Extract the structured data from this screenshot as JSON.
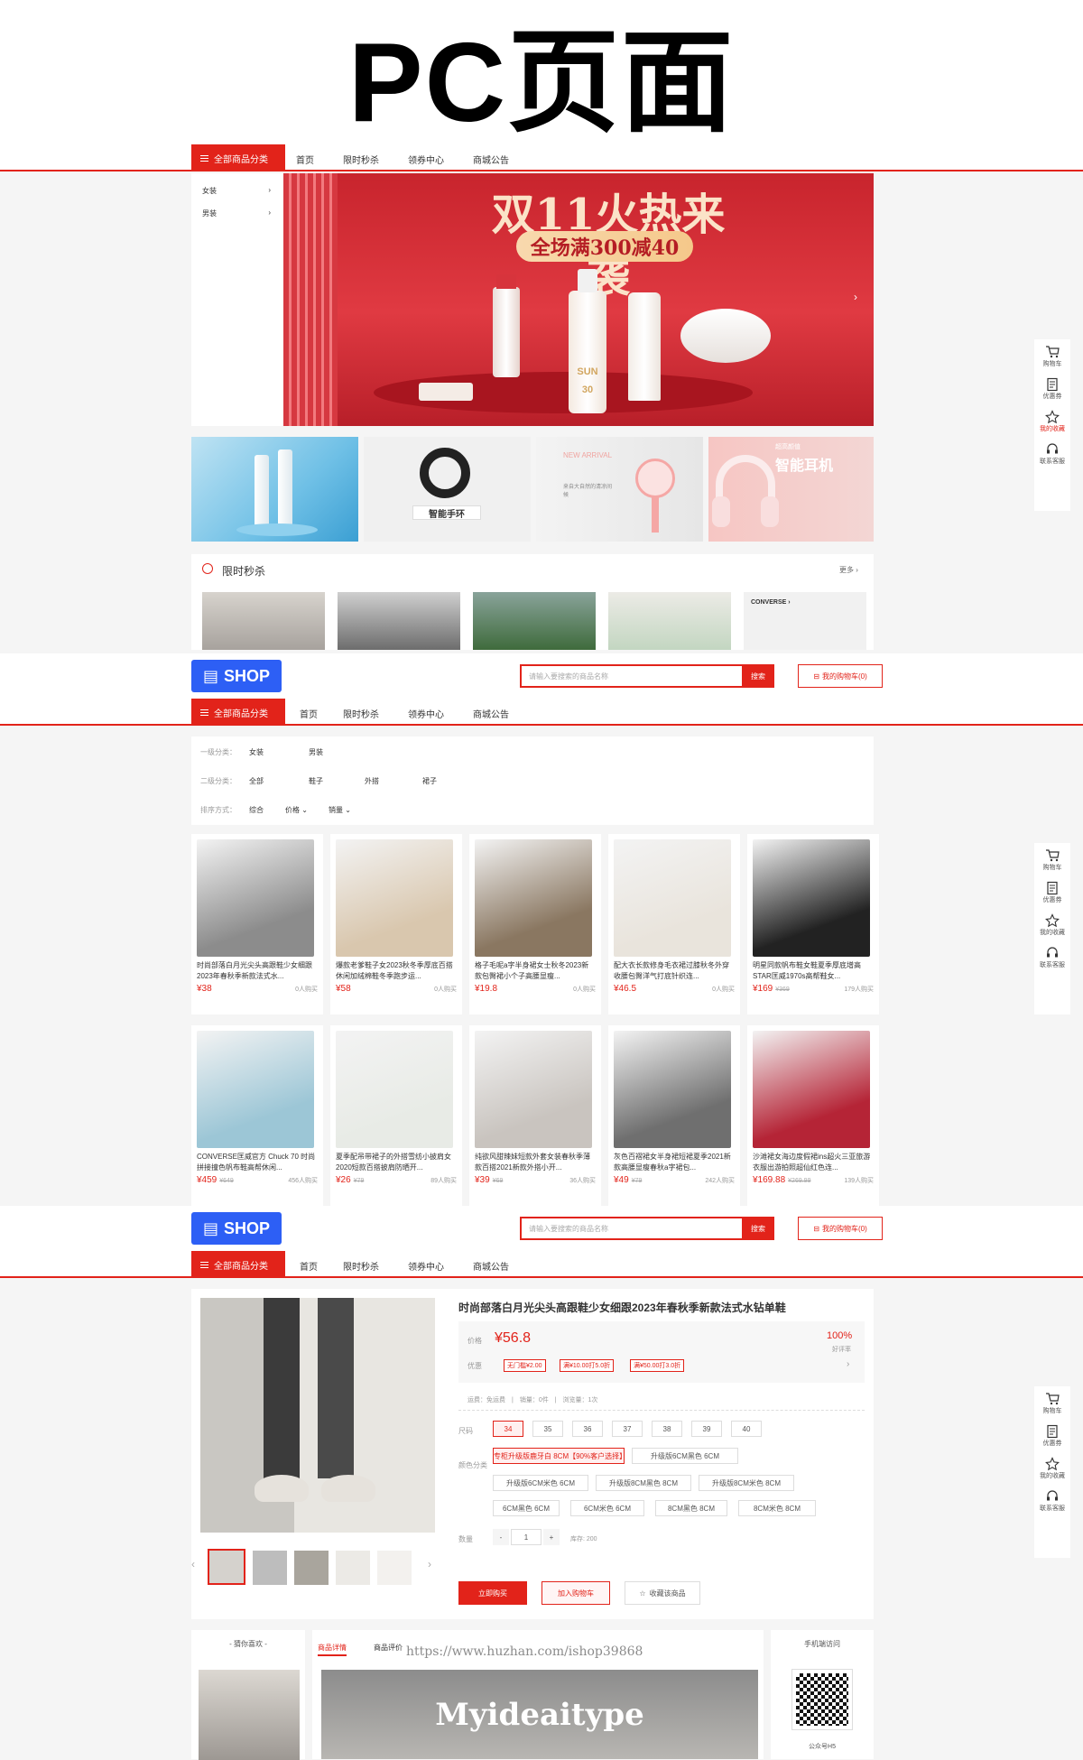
{
  "page_title": "PC页面",
  "nav": {
    "all": "全部商品分类",
    "items": [
      "首页",
      "限时秒杀",
      "领券中心",
      "商城公告"
    ]
  },
  "categories": [
    "女装",
    "男装"
  ],
  "banner": {
    "headline": "双11火热来袭",
    "sub": "全场满300减40",
    "tube_text": "SUN",
    "tube_num": "30"
  },
  "promos": [
    {
      "text": ""
    },
    {
      "text": "智能手环"
    },
    {
      "text": "NEW ARRIVAL",
      "text2": "来自大自然的清凉间候"
    },
    {
      "text": "超高颜值",
      "text2": "智能耳机"
    }
  ],
  "flash": {
    "title": "限时秒杀",
    "more": "更多"
  },
  "sidebar": [
    {
      "icon": "cart-icon",
      "label": "购物车"
    },
    {
      "icon": "coupon-icon",
      "label": "优惠券"
    },
    {
      "icon": "star-icon",
      "label": "我的收藏"
    },
    {
      "icon": "headset-icon",
      "label": "联系客服"
    }
  ],
  "shop": {
    "logo": "SHOP",
    "search_placeholder": "请输入要搜索的商品名称",
    "search_btn": "搜索",
    "cart": "我的购物车(0)"
  },
  "filter": {
    "l1": "一级分类：",
    "l1v": [
      "女装",
      "男装"
    ],
    "l2": "二级分类：",
    "l2v": [
      "全部",
      "鞋子",
      "外搭",
      "裙子"
    ],
    "l3": "排序方式：",
    "l3v": [
      "综合",
      "价格",
      "销量"
    ]
  },
  "products": [
    {
      "name": "时尚部落白月光尖头高跟鞋少女细跟2023年春秋季新款法式水...",
      "price": "¥38",
      "old": "",
      "sold": "0人购买",
      "color": "#8c8c8c"
    },
    {
      "name": "爆款老爹鞋子女2023秋冬季厚底百搭休闲加绒棉鞋冬季跑步运...",
      "price": "¥58",
      "old": "",
      "sold": "0人购买",
      "color": "#d9c7ae"
    },
    {
      "name": "格子毛呢a字半身裙女士秋冬2023新款包臀裙小个子高腰显瘦...",
      "price": "¥19.8",
      "old": "",
      "sold": "0人购买",
      "color": "#8a7761"
    },
    {
      "name": "配大衣长款修身毛衣裙过膝秋冬外穿收腰包臀洋气打底针织连...",
      "price": "¥46.5",
      "old": "",
      "sold": "0人购买",
      "color": "#e9e4dc"
    },
    {
      "name": "明星同款帆布鞋女鞋夏季厚底增高STAR匡威1970s高帮鞋女...",
      "price": "¥169",
      "old": "¥369",
      "sold": "179人购买",
      "color": "#222222"
    },
    {
      "name": "CONVERSE匡威官方 Chuck 70 时尚拼接撞色帆布鞋高帮休闲...",
      "price": "¥459",
      "old": "¥649",
      "sold": "456人购买",
      "color": "#9cc6d6"
    },
    {
      "name": "夏季配吊带裙子的外搭雪纺小披肩女2020短款百搭披肩防晒开...",
      "price": "¥26",
      "old": "¥79",
      "sold": "89人购买",
      "color": "#e8ebe6"
    },
    {
      "name": "纯欲风甜辣妹短款外套女装春秋季薄款百搭2021新款外搭小开...",
      "price": "¥39",
      "old": "¥69",
      "sold": "36人购买",
      "color": "#c9c4bf"
    },
    {
      "name": "灰色百褶裙女半身裙短裙夏季2021新款高腰显瘦春秋a字裙包...",
      "price": "¥49",
      "old": "¥79",
      "sold": "242人购买",
      "color": "#6f6f6f"
    },
    {
      "name": "沙滩裙女海边度假裙ins超火三亚旅游衣服出游拍照超仙红色连...",
      "price": "¥169.88",
      "old": "¥269.99",
      "sold": "139人购买",
      "color": "#b52436"
    }
  ],
  "detail": {
    "title": "时尚部落白月光尖头高跟鞋少女细跟2023年春秋季新款法式水钻单鞋",
    "price_lbl": "价格",
    "price": "¥56.8",
    "good": "100%",
    "good_lbl": "好评率",
    "disc_lbl": "优惠",
    "coupons": [
      "无门槛¥2.00",
      "满¥10.00打5.0折",
      "满¥50.00打3.0折"
    ],
    "meta": "运费：免运费　|　销量：0件　|　浏览量：1次",
    "size_lbl": "尺码",
    "sizes": [
      "34",
      "35",
      "36",
      "37",
      "38",
      "39",
      "40"
    ],
    "color_lbl": "颜色分类",
    "colors": [
      "专柜升级版鹿牙白 8CM【90%客户选择】",
      "升级版6CM黑色 6CM",
      "升级版6CM米色 6CM",
      "升级版8CM黑色 8CM",
      "升级版8CM米色 8CM",
      "6CM黑色 6CM",
      "6CM米色 6CM",
      "8CM黑色 8CM",
      "8CM米色 8CM"
    ],
    "qty_lbl": "数量",
    "qty": "1",
    "stock": "库存: 200",
    "buy": "立即购买",
    "addcart": "加入购物车",
    "fav": "收藏该商品"
  },
  "bottom": {
    "guess": "- 猜你喜欢 -",
    "tab1": "商品详情",
    "tab2": "商品评价",
    "watermark": "https://www.huzhan.com/ishop39868",
    "brand": "Myideaitype",
    "mobile": "手机端访问",
    "wechat": "公众号H5"
  }
}
